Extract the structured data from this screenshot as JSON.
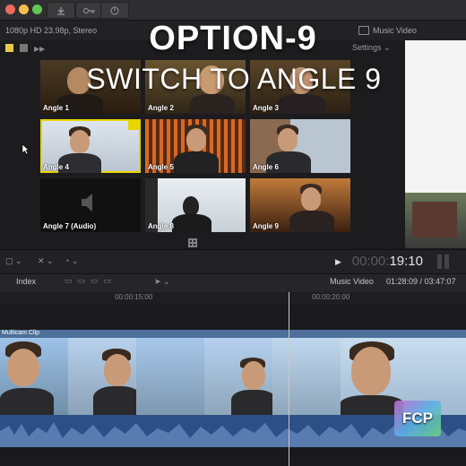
{
  "titlebar": {
    "traffic_colors": [
      "#ed6a5e",
      "#f5bf4f",
      "#61c554"
    ],
    "download_icon": "download-arrow-icon",
    "key_icon": "key-icon",
    "check_icon": "checkmark-circle-icon"
  },
  "infobar": {
    "format": "1080p HD 23.98p, Stereo",
    "project_name": "Music Video"
  },
  "viewer": {
    "settings_label": "Settings",
    "overlay_title": "OPTION-9",
    "overlay_subtitle": "SWITCH TO ANGLE 9",
    "angles": [
      {
        "label": "Angle 1",
        "active": false
      },
      {
        "label": "Angle 2",
        "active": false
      },
      {
        "label": "Angle 3",
        "active": false
      },
      {
        "label": "Angle 4",
        "active": true
      },
      {
        "label": "Angle 5",
        "active": false
      },
      {
        "label": "Angle 6",
        "active": false
      },
      {
        "label": "Angle 7 (Audio)",
        "active": false
      },
      {
        "label": "Angle 8",
        "active": false
      },
      {
        "label": "Angle 9",
        "active": false
      }
    ]
  },
  "transport": {
    "timecode_dim": "00:00:",
    "timecode": "19:10"
  },
  "timeline": {
    "index_label": "Index",
    "project_name": "Music Video",
    "position": "01:28:09 / 03:47:07",
    "ruler_marks": [
      "00:00:15:00",
      "00:00:20:00"
    ],
    "clip_name": "Multicam Clip"
  },
  "colors": {
    "active_angle": "#e8d400",
    "clip_blue": "#4d6f9a",
    "audio_blue": "#2c4f86"
  },
  "badge": {
    "text": "FCP"
  }
}
